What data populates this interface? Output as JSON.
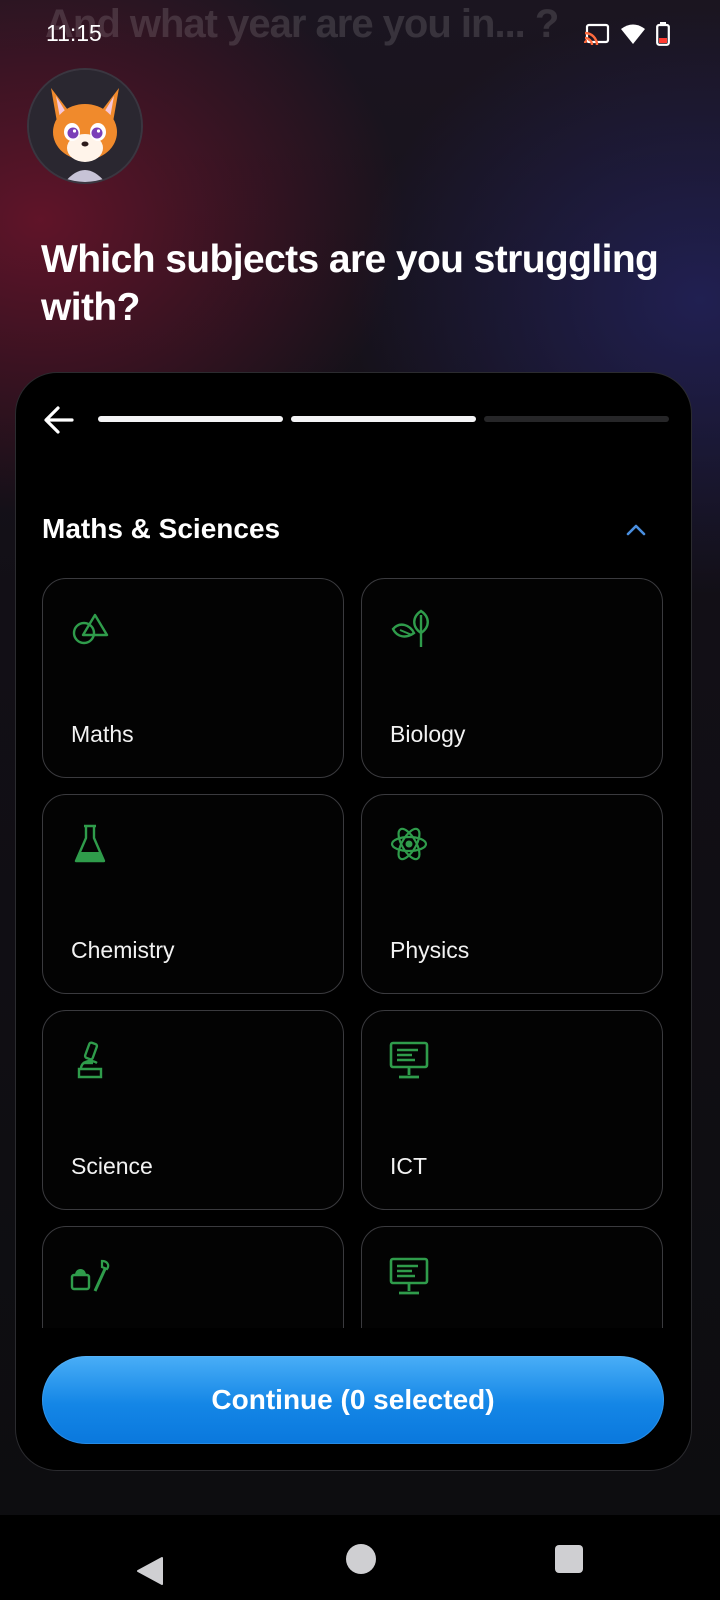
{
  "status_bar": {
    "time": "11:15",
    "icons": [
      "cast-icon",
      "wifi-icon",
      "battery-icon"
    ]
  },
  "previous_question": "And what year are you in... ?",
  "question": "Which subjects are you struggling with?",
  "progress": {
    "steps": 3,
    "completed": 2
  },
  "section": {
    "title": "Maths & Sciences",
    "expanded": true
  },
  "subjects": [
    {
      "label": "Maths",
      "icon": "shapes-icon"
    },
    {
      "label": "Biology",
      "icon": "leaf-plant-icon"
    },
    {
      "label": "Chemistry",
      "icon": "flask-icon"
    },
    {
      "label": "Physics",
      "icon": "atom-icon"
    },
    {
      "label": "Science",
      "icon": "microscope-icon"
    },
    {
      "label": "ICT",
      "icon": "computer-monitor-icon"
    },
    {
      "label": "",
      "icon": "tools-icon"
    },
    {
      "label": "",
      "icon": "computer-monitor-icon"
    }
  ],
  "continue_button": {
    "label": "Continue (0 selected)"
  },
  "colors": {
    "accent_green": "#2f9c4b",
    "button_blue": "#1486e6",
    "chevron_blue": "#4a8fe0"
  }
}
